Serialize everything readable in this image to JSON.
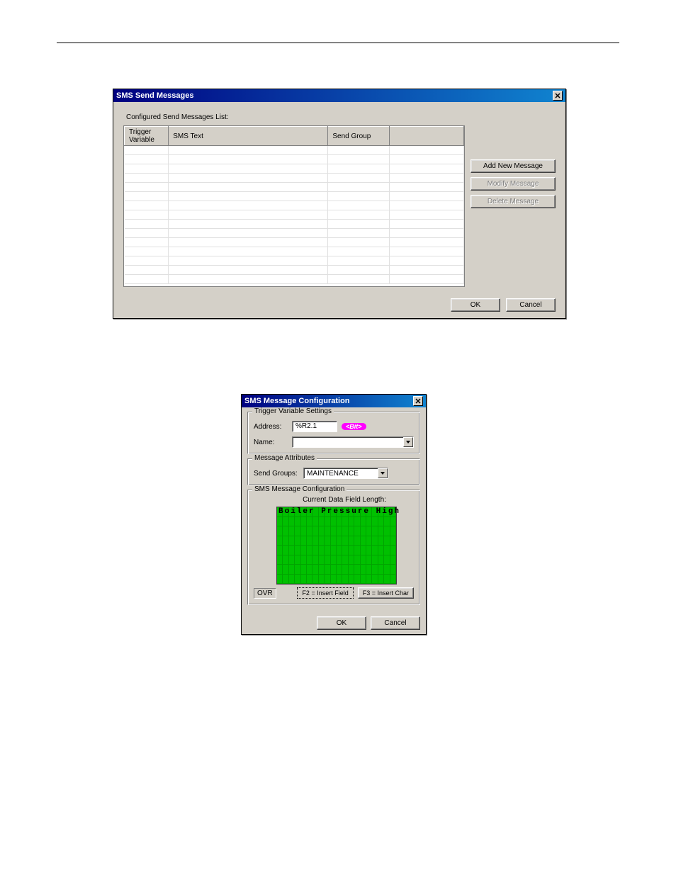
{
  "dialog1": {
    "title": "SMS Send Messages",
    "list_label": "Configured Send Messages List:",
    "columns": {
      "trigger": "Trigger Variable",
      "text": "SMS Text",
      "group": "Send Group"
    },
    "buttons": {
      "add": "Add New Message",
      "modify": "Modify Message",
      "delete": "Delete Message",
      "ok": "OK",
      "cancel": "Cancel"
    }
  },
  "dialog2": {
    "title": "SMS Message Configuration",
    "trigger_section": "Trigger Variable Settings",
    "address_label": "Address:",
    "address_value": "%R2.1",
    "bit_tag": "<Bit>",
    "name_label": "Name:",
    "name_value": "",
    "attrs_section": "Message Attributes",
    "send_groups_label": "Send Groups:",
    "send_groups_value": "MAINTENANCE",
    "config_section": "SMS Message Configuration",
    "data_field_length_label": "Current Data Field Length:",
    "lcd_text": "Boiler Pressure High",
    "ovr": "OVR",
    "f2": "F2 = Insert Field",
    "f3": "F3 = Insert Char",
    "ok": "OK",
    "cancel": "Cancel"
  }
}
